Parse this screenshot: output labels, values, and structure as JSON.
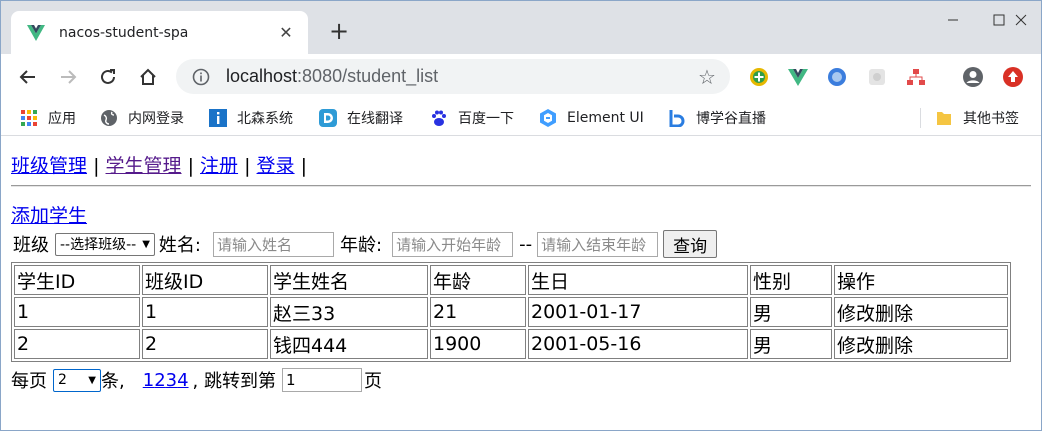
{
  "browser": {
    "tab_title": "nacos-student-spa",
    "url_host": "localhost",
    "url_rest": ":8080/student_list",
    "bookmarks": [
      {
        "label": "应用",
        "icon": "apps-grid-icon"
      },
      {
        "label": "内网登录",
        "icon": "globe-icon"
      },
      {
        "label": "北森系统",
        "icon": "info-i-icon"
      },
      {
        "label": "在线翻译",
        "icon": "translate-d-icon"
      },
      {
        "label": "百度一下",
        "icon": "baidu-paw-icon"
      },
      {
        "label": "Element UI",
        "icon": "element-ui-icon"
      },
      {
        "label": "博学谷直播",
        "icon": "bxg-b-icon"
      }
    ],
    "other_bookmarks": "其他书签"
  },
  "nav": {
    "items": [
      "班级管理",
      "学生管理",
      "注册",
      "登录"
    ],
    "sep": "|"
  },
  "add_link": "添加学生",
  "filters": {
    "class_label": "班级",
    "class_select": "--选择班级--",
    "name_label": "姓名:",
    "name_placeholder": "请输入姓名",
    "age_label": "年龄:",
    "age_start_placeholder": "请输入开始年龄",
    "age_dash": "--",
    "age_end_placeholder": "请输入结束年龄",
    "search_button": "查询"
  },
  "table": {
    "headers": [
      "学生ID",
      "班级ID",
      "学生姓名",
      "年龄",
      "生日",
      "性别",
      "操作"
    ],
    "rows": [
      {
        "id": "1",
        "class_id": "1",
        "name": "赵三33",
        "age": "21",
        "birthday": "2001-01-17",
        "gender": "男",
        "edit": "修改",
        "delete": "删除"
      },
      {
        "id": "2",
        "class_id": "2",
        "name": "钱四444",
        "age": "1900",
        "birthday": "2001-05-16",
        "gender": "男",
        "edit": "修改",
        "delete": "删除"
      }
    ]
  },
  "pager": {
    "per_page_label": "每页",
    "per_page_value": "2",
    "unit": "条,",
    "pages": [
      "1",
      "2",
      "3",
      "4"
    ],
    "jump_label": ", 跳转到第",
    "jump_value": "1",
    "page_suffix": "页"
  },
  "colors": {
    "link": "#0000ee",
    "visited": "#551a8b",
    "tabstrip_bg": "#dee1e6",
    "omnibox_bg": "#f1f3f4"
  }
}
